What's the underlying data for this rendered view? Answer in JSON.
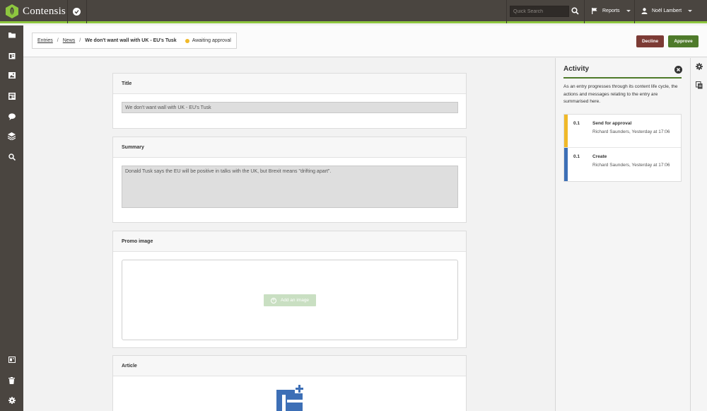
{
  "app": {
    "name": "Contensis"
  },
  "topbar": {
    "search_placeholder": "Quick Search",
    "reports_label": "Reports",
    "user_name": "Noël Lambert"
  },
  "sidebar": {
    "icons": [
      "folder-icon",
      "entries-icon",
      "image-icon",
      "content-types-icon",
      "comments-icon",
      "blocks-icon",
      "search-icon",
      "preview-icon",
      "trash-icon",
      "settings-icon"
    ]
  },
  "breadcrumb": {
    "items": [
      "Entries",
      "News"
    ],
    "current": "We don't want wall with UK - EU's Tusk",
    "status": "Awaiting approval",
    "status_color": "#f0b929"
  },
  "actions": {
    "decline_label": "Decline",
    "approve_label": "Approve"
  },
  "fields": {
    "title": {
      "label": "Title",
      "value": "We don't want wall with UK - EU's Tusk"
    },
    "summary": {
      "label": "Summary",
      "value": "Donald Tusk says the EU will be positive in talks with the UK, but Brexit means \"drifting apart\"."
    },
    "promo_image": {
      "label": "Promo image",
      "button_label": "Add an image"
    },
    "article": {
      "label": "Article"
    }
  },
  "activity": {
    "title": "Activity",
    "description": "As an entry progresses through its content life cycle, the actions and messages relating to the entry are summarised here.",
    "items": [
      {
        "version": "0.1",
        "title": "Send for approval",
        "meta": "Richard Saunders, Yesterday at 17:06",
        "color": "#f0b929"
      },
      {
        "version": "0.1",
        "title": "Create",
        "meta": "Richard Saunders, Yesterday at 17:06",
        "color": "#3d6fb6"
      }
    ]
  },
  "colors": {
    "topbar": "#4a4540",
    "accent": "#8dc63f",
    "approve": "#4e7a2a",
    "decline": "#7c3b35"
  }
}
